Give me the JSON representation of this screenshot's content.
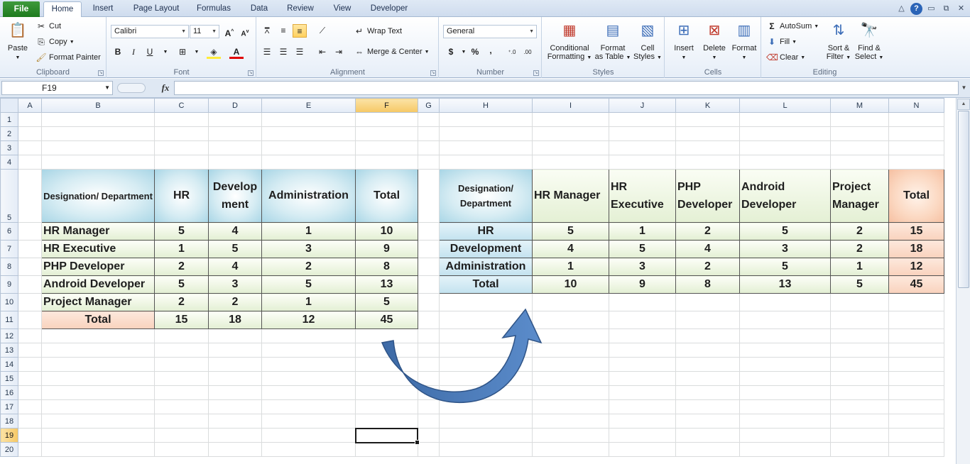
{
  "tabs": {
    "file": "File",
    "items": [
      "Home",
      "Insert",
      "Page Layout",
      "Formulas",
      "Data",
      "Review",
      "View",
      "Developer"
    ],
    "active": "Home"
  },
  "ribbon": {
    "clipboard": {
      "label": "Clipboard",
      "paste": "Paste",
      "cut": "Cut",
      "copy": "Copy",
      "format_painter": "Format Painter"
    },
    "font": {
      "label": "Font",
      "name": "Calibri",
      "size": "11",
      "bold": "B",
      "italic": "I",
      "underline": "U"
    },
    "alignment": {
      "label": "Alignment",
      "wrap_text": "Wrap Text",
      "merge_center": "Merge & Center"
    },
    "number": {
      "label": "Number",
      "format": "General",
      "currency": "$",
      "percent": "%",
      "comma": ","
    },
    "styles": {
      "label": "Styles",
      "conditional": [
        "Conditional",
        "Formatting"
      ],
      "format_table": [
        "Format",
        "as Table"
      ],
      "cell_styles": [
        "Cell",
        "Styles"
      ]
    },
    "cells": {
      "label": "Cells",
      "insert": "Insert",
      "delete": "Delete",
      "format": "Format"
    },
    "editing": {
      "label": "Editing",
      "autosum": "AutoSum",
      "fill": "Fill",
      "clear": "Clear",
      "sort": [
        "Sort &",
        "Filter"
      ],
      "find": [
        "Find &",
        "Select"
      ]
    }
  },
  "formula_bar": {
    "name_box": "F19",
    "fx": "fx",
    "value": ""
  },
  "grid": {
    "columns": [
      "A",
      "B",
      "C",
      "D",
      "E",
      "F",
      "G",
      "H",
      "I",
      "J",
      "K",
      "L",
      "M",
      "N"
    ],
    "selected_column": "F",
    "selected_row": "19",
    "rows": [
      "1",
      "2",
      "3",
      "4",
      "5",
      "6",
      "7",
      "8",
      "9",
      "10",
      "11",
      "12",
      "13",
      "14",
      "15",
      "16",
      "17",
      "18",
      "19",
      "20"
    ]
  },
  "table1": {
    "header": [
      "Designation/ Department",
      "HR",
      "Development",
      "Administration",
      "Total"
    ],
    "rows": [
      [
        "HR Manager",
        "5",
        "4",
        "1",
        "10"
      ],
      [
        "HR Executive",
        "1",
        "5",
        "3",
        "9"
      ],
      [
        "PHP Developer",
        "2",
        "4",
        "2",
        "8"
      ],
      [
        "Android Developer",
        "5",
        "3",
        "5",
        "13"
      ],
      [
        "Project Manager",
        "2",
        "2",
        "1",
        "5"
      ]
    ],
    "total": [
      "Total",
      "15",
      "18",
      "12",
      "45"
    ]
  },
  "table2": {
    "header": [
      "Designation/ Department",
      "HR Manager",
      "HR Executive",
      "PHP Developer",
      "Android Developer",
      "Project Manager",
      "Total"
    ],
    "rows": [
      [
        "HR",
        "5",
        "1",
        "2",
        "5",
        "2",
        "15"
      ],
      [
        "Development",
        "4",
        "5",
        "4",
        "3",
        "2",
        "18"
      ],
      [
        "Administration",
        "1",
        "3",
        "2",
        "5",
        "1",
        "12"
      ],
      [
        "Total",
        "10",
        "9",
        "8",
        "13",
        "5",
        "45"
      ]
    ]
  },
  "colors": {
    "accent_blue": "#2b579a",
    "header_blue": "#b7dde8",
    "total_orange": "#f9d2bd",
    "body_green": "#e3efd3",
    "arrow": "#4f81bd"
  }
}
